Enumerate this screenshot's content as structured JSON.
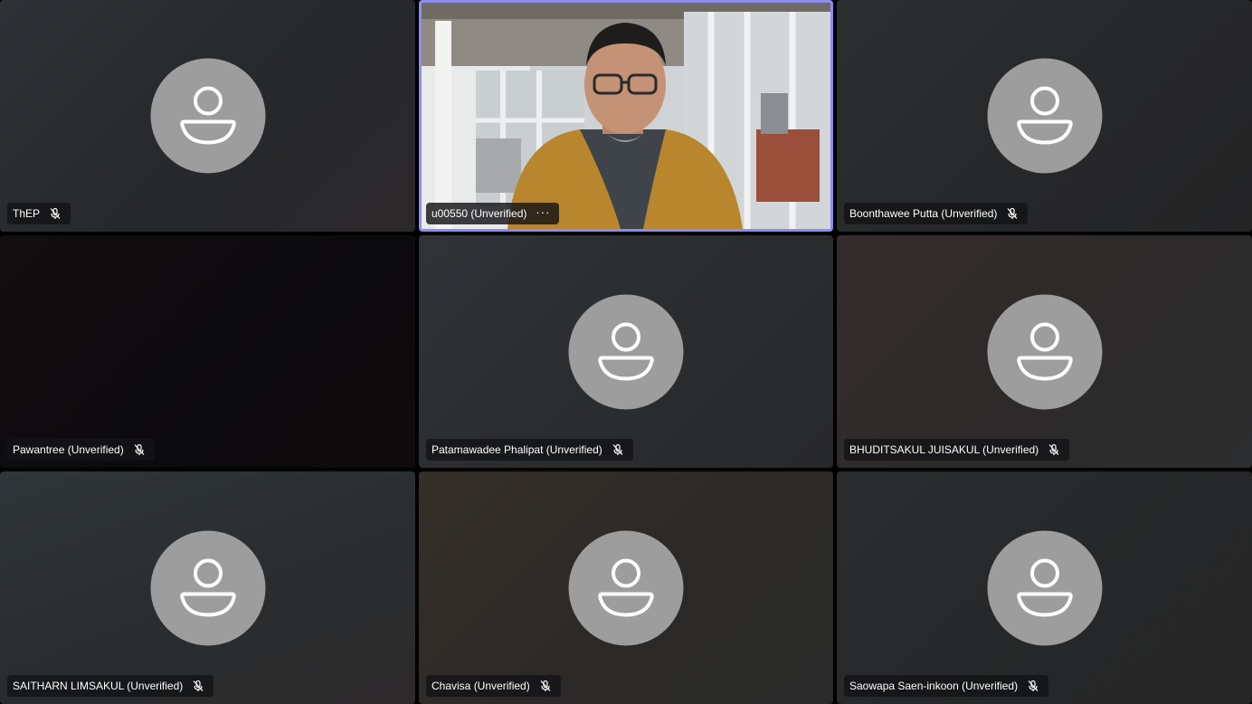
{
  "participants": [
    {
      "name": "ThEP",
      "muted": true
    },
    {
      "name": "u00550 (Unverified)",
      "video": true,
      "active_speaker": true,
      "more_menu": "···"
    },
    {
      "name": "Boonthawee Putta (Unverified)",
      "muted": true
    },
    {
      "name": "Pawantree (Unverified)",
      "muted": true,
      "camera_dark": true
    },
    {
      "name": "Patamawadee Phalipat (Unverified)",
      "muted": true
    },
    {
      "name": "BHUDITSAKUL JUISAKUL (Unverified)",
      "muted": true
    },
    {
      "name": "SAITHARN LIMSAKUL (Unverified)",
      "muted": true
    },
    {
      "name": "Chavisa (Unverified)",
      "muted": true
    },
    {
      "name": "Saowapa Saen-inkoon (Unverified)",
      "muted": true
    }
  ],
  "icons": {
    "avatar": "person-icon",
    "muted": "mic-off-icon",
    "more": "more-options-icon"
  },
  "colors": {
    "active_speaker_border": "#8e8cf0",
    "avatar_bg": "#9d9d9d",
    "chip_bg": "#141416"
  }
}
